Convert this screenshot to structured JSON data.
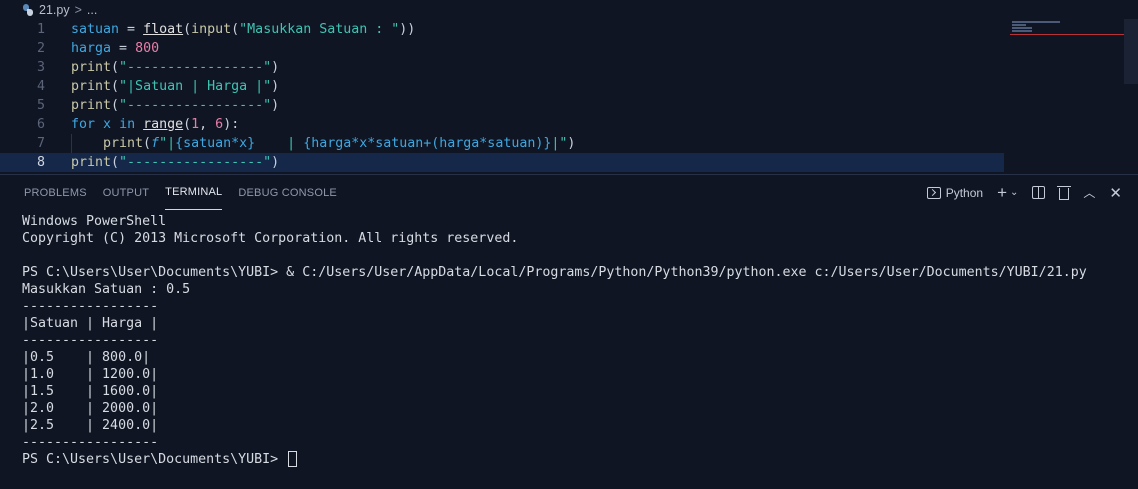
{
  "breadcrumb": {
    "file": "21.py",
    "sep": ">",
    "rest": "..."
  },
  "editor": {
    "current_line": 8,
    "lines": [
      {
        "n": "1"
      },
      {
        "n": "2"
      },
      {
        "n": "3"
      },
      {
        "n": "4"
      },
      {
        "n": "5"
      },
      {
        "n": "6"
      },
      {
        "n": "7"
      },
      {
        "n": "8"
      }
    ],
    "code": {
      "l1": {
        "var": "satuan",
        "eq": " = ",
        "fn": "float",
        "p1": "(",
        "fn2": "input",
        "p2": "(",
        "str": "\"Masukkan Satuan : \"",
        "p3": "))"
      },
      "l2": {
        "var": "harga",
        "eq": " = ",
        "num": "800"
      },
      "l3": {
        "fn": "print",
        "p1": "(",
        "str": "\"-----------------\"",
        "p2": ")"
      },
      "l4": {
        "fn": "print",
        "p1": "(",
        "str": "\"|Satuan | Harga |\"",
        "p2": ")"
      },
      "l5": {
        "fn": "print",
        "p1": "(",
        "str": "\"-----------------\"",
        "p2": ")"
      },
      "l6": {
        "kw": "for",
        "var": " x ",
        "kw2": "in",
        "sp": " ",
        "fn": "range",
        "p1": "(",
        "n1": "1",
        "c": ", ",
        "n2": "6",
        "p2": "):"
      },
      "l7": {
        "fn": "print",
        "p1": "(",
        "f": "f",
        "s1": "\"|",
        "b1": "{satuan*x}",
        "s2": "    | ",
        "b2": "{harga*x*satuan+(harga*satuan)}",
        "s3": "|\"",
        "p2": ")"
      },
      "l8": {
        "fn": "print",
        "p1": "(",
        "str": "\"-----------------\"",
        "p2": ")"
      }
    }
  },
  "panel": {
    "tabs": [
      "PROBLEMS",
      "OUTPUT",
      "TERMINAL",
      "DEBUG CONSOLE"
    ],
    "active_tab": "TERMINAL",
    "shell_label": "Python"
  },
  "terminal": {
    "lines": [
      "Windows PowerShell",
      "Copyright (C) 2013 Microsoft Corporation. All rights reserved.",
      "",
      "PS C:\\Users\\User\\Documents\\YUBI> & C:/Users/User/AppData/Local/Programs/Python/Python39/python.exe c:/Users/User/Documents/YUBI/21.py",
      "Masukkan Satuan : 0.5",
      "-----------------",
      "|Satuan | Harga |",
      "-----------------",
      "|0.5    | 800.0|",
      "|1.0    | 1200.0|",
      "|1.5    | 1600.0|",
      "|2.0    | 2000.0|",
      "|2.5    | 2400.0|",
      "-----------------"
    ],
    "prompt": "PS C:\\Users\\User\\Documents\\YUBI>"
  },
  "colors": {
    "background": "#0f1523",
    "current_line": "#15284a",
    "keyword": "#3fa7e0",
    "string": "#3fc4b3",
    "number": "#e87fa8"
  }
}
